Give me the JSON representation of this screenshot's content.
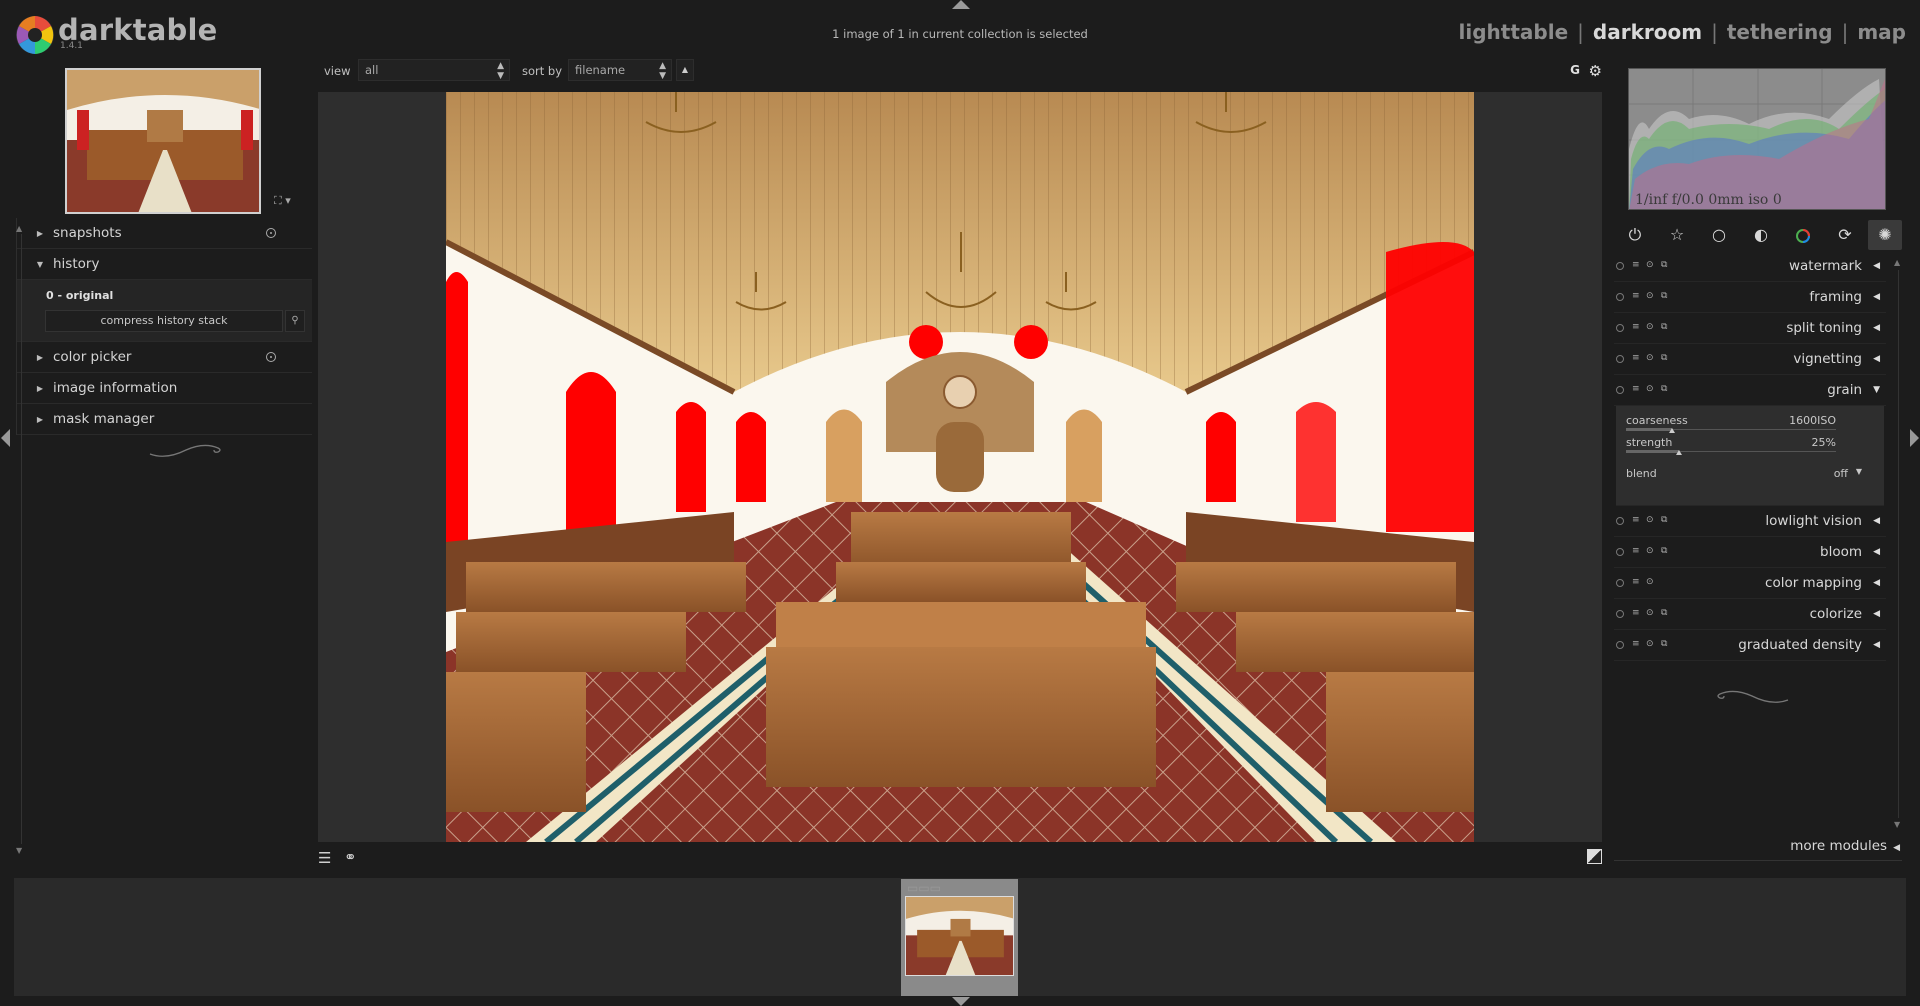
{
  "app": {
    "name": "darktable",
    "version": "1.4.1"
  },
  "collection_status": "1 image of 1 in current collection is selected",
  "views": [
    {
      "label": "lighttable",
      "active": false
    },
    {
      "label": "darkroom",
      "active": true
    },
    {
      "label": "tethering",
      "active": false
    },
    {
      "label": "map",
      "active": false
    }
  ],
  "toolbar": {
    "view_label": "view",
    "view_value": "all",
    "sort_label": "sort by",
    "sort_value": "filename",
    "grouping_label": "G"
  },
  "left_modules": [
    {
      "label": "snapshots",
      "expanded": false,
      "presets": true
    },
    {
      "label": "history",
      "expanded": true,
      "presets": false
    },
    {
      "label": "color picker",
      "expanded": false,
      "presets": true
    },
    {
      "label": "image information",
      "expanded": false,
      "presets": false
    },
    {
      "label": "mask manager",
      "expanded": false,
      "presets": false
    }
  ],
  "history": {
    "items": [
      "0 - original"
    ],
    "compress_label": "compress history stack"
  },
  "histogram": {
    "info": "1/inf f/0.0 0mm iso 0"
  },
  "module_groups": [
    "power-icon",
    "star-icon",
    "circle-icon",
    "half-circle-icon",
    "color-circle-icon",
    "refresh-icon",
    "aperture-icon"
  ],
  "right_modules": [
    {
      "label": "watermark",
      "expanded": false
    },
    {
      "label": "framing",
      "expanded": false
    },
    {
      "label": "split toning",
      "expanded": false
    },
    {
      "label": "vignetting",
      "expanded": false
    },
    {
      "label": "grain",
      "expanded": true
    },
    {
      "label": "lowlight vision",
      "expanded": false
    },
    {
      "label": "bloom",
      "expanded": false
    },
    {
      "label": "color mapping",
      "expanded": false
    },
    {
      "label": "colorize",
      "expanded": false
    },
    {
      "label": "graduated density",
      "expanded": false
    }
  ],
  "grain": {
    "coarseness_label": "coarseness",
    "coarseness_value": "1600ISO",
    "coarseness_fraction": 0.22,
    "strength_label": "strength",
    "strength_value": "25%",
    "strength_fraction": 0.25,
    "blend_label": "blend",
    "blend_value": "off"
  },
  "more_modules_label": "more modules",
  "colors": {
    "accent_red": "#ff0000",
    "panel_bg": "#1c1c1c",
    "center_bg": "#2e2e2e"
  }
}
